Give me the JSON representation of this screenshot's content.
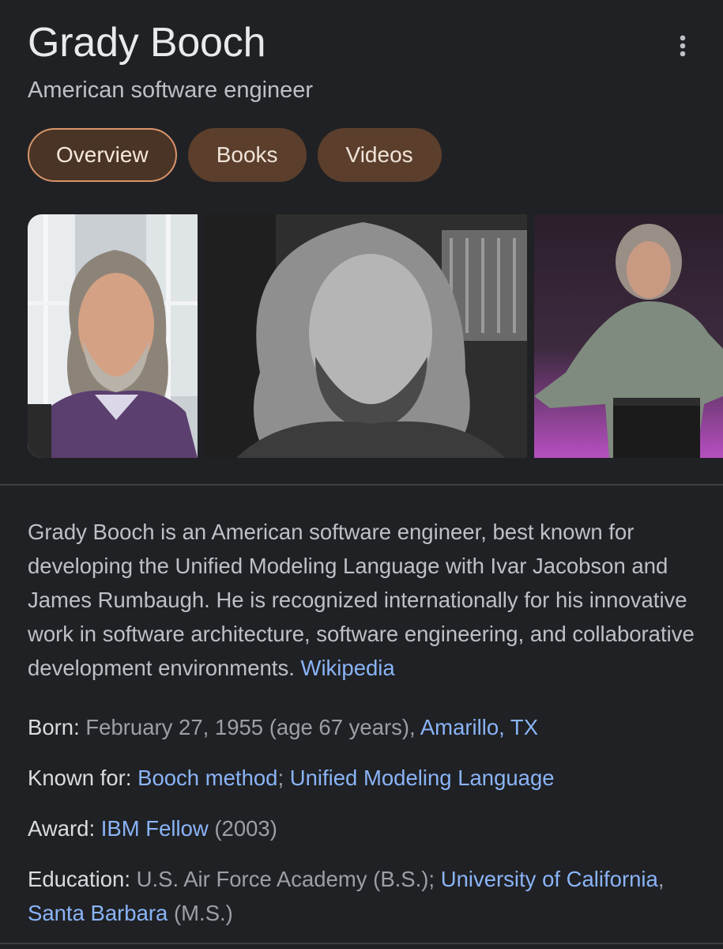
{
  "panel": {
    "title": "Grady Booch",
    "subtitle": "American software engineer",
    "more_icon": "more-vert-icon"
  },
  "tabs": [
    {
      "label": "Overview",
      "active": true
    },
    {
      "label": "Books",
      "active": false
    },
    {
      "label": "Videos",
      "active": false
    }
  ],
  "description": {
    "text": "Grady Booch is an American software engineer, best known for developing the Unified Modeling Language with Ivar Jacobson and James Rumbaugh. He is recognized internationally for his innovative work in software architecture, software engineering, and collaborative development environments.",
    "source_link": "Wikipedia"
  },
  "facts": {
    "born": {
      "label": "Born:",
      "value": "February 27, 1955 (age 67 years), ",
      "place_link": "Amarillo, TX"
    },
    "known_for": {
      "label": "Known for:",
      "link1": "Booch method",
      "sep": "; ",
      "link2": "Unified Modeling Language"
    },
    "award": {
      "label": "Award:",
      "link": "IBM Fellow",
      "year": " (2003)"
    },
    "education": {
      "label": "Education:",
      "value1": "U.S. Air Force Academy (B.S.); ",
      "link1": "University of California",
      "comma": ", ",
      "link2": "Santa Barbara",
      "value2": " (M.S.)"
    }
  },
  "colors": {
    "background": "#202124",
    "chip_fill": "#5b3f2c",
    "chip_active_border": "#d8956a",
    "link": "#8ab4f8"
  }
}
